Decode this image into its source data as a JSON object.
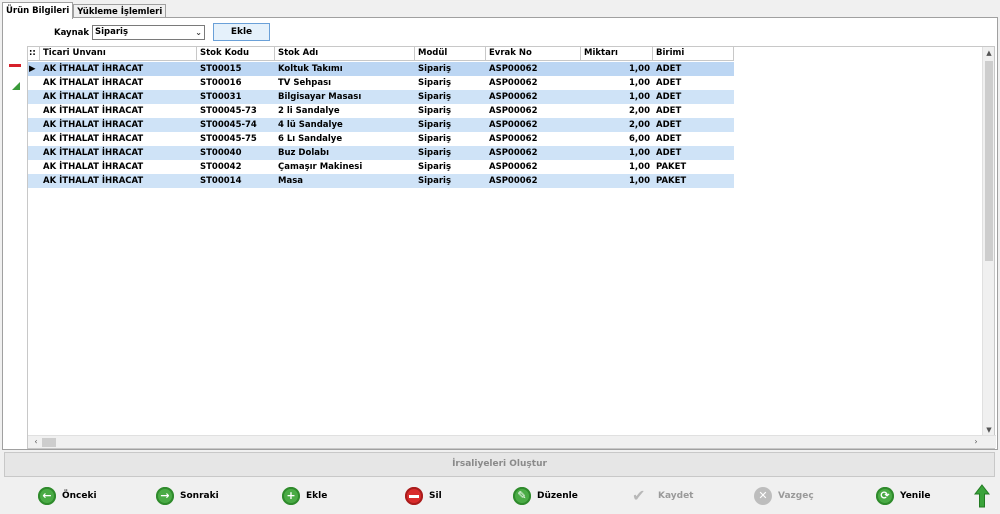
{
  "tabs": [
    {
      "label": "Ürün Bilgileri",
      "active": true
    },
    {
      "label": "Yükleme İşlemleri",
      "active": false
    }
  ],
  "toolbar": {
    "kaynak_label": "Kaynak",
    "kaynak_value": "Sipariş",
    "ekle_label": "Ekle"
  },
  "grid": {
    "columns": [
      "Ticari Unvanı",
      "Stok Kodu",
      "Stok Adı",
      "Modül",
      "Evrak No",
      "Miktarı",
      "Birimi"
    ],
    "rows": [
      {
        "unvan": "AK İTHALAT İHRACAT",
        "kod": "ST00015",
        "ad": "Koltuk Takımı",
        "modul": "Sipariş",
        "evrak": "ASP00062",
        "miktar": "1,00",
        "birim": "ADET"
      },
      {
        "unvan": "AK İTHALAT İHRACAT",
        "kod": "ST00016",
        "ad": "TV Sehpası",
        "modul": "Sipariş",
        "evrak": "ASP00062",
        "miktar": "1,00",
        "birim": "ADET"
      },
      {
        "unvan": "AK İTHALAT İHRACAT",
        "kod": "ST00031",
        "ad": "Bilgisayar Masası",
        "modul": "Sipariş",
        "evrak": "ASP00062",
        "miktar": "1,00",
        "birim": "ADET"
      },
      {
        "unvan": "AK İTHALAT İHRACAT",
        "kod": "ST00045-73",
        "ad": "2 li Sandalye",
        "modul": "Sipariş",
        "evrak": "ASP00062",
        "miktar": "2,00",
        "birim": "ADET"
      },
      {
        "unvan": "AK İTHALAT İHRACAT",
        "kod": "ST00045-74",
        "ad": "4 lü Sandalye",
        "modul": "Sipariş",
        "evrak": "ASP00062",
        "miktar": "2,00",
        "birim": "ADET"
      },
      {
        "unvan": "AK İTHALAT İHRACAT",
        "kod": "ST00045-75",
        "ad": "6 Lı Sandalye",
        "modul": "Sipariş",
        "evrak": "ASP00062",
        "miktar": "6,00",
        "birim": "ADET"
      },
      {
        "unvan": "AK İTHALAT İHRACAT",
        "kod": "ST00040",
        "ad": "Buz Dolabı",
        "modul": "Sipariş",
        "evrak": "ASP00062",
        "miktar": "1,00",
        "birim": "ADET"
      },
      {
        "unvan": "AK İTHALAT İHRACAT",
        "kod": "ST00042",
        "ad": "Çamaşır Makinesi",
        "modul": "Sipariş",
        "evrak": "ASP00062",
        "miktar": "1,00",
        "birim": "PAKET"
      },
      {
        "unvan": "AK İTHALAT İHRACAT",
        "kod": "ST00014",
        "ad": "Masa",
        "modul": "Sipariş",
        "evrak": "ASP00062",
        "miktar": "1,00",
        "birim": "PAKET"
      }
    ]
  },
  "irsaliye_button": "İrsaliyeleri Oluştur",
  "nav": {
    "onceki": "Önceki",
    "sonraki": "Sonraki",
    "ekle": "Ekle",
    "sil": "Sil",
    "duzenle": "Düzenle",
    "kaydet": "Kaydet",
    "vazgec": "Vazgeç",
    "yenile": "Yenile"
  },
  "colors": {
    "row_alt": "#cfe3f7",
    "accent_green": "#4aab45",
    "delete_red": "#d92b2b"
  }
}
